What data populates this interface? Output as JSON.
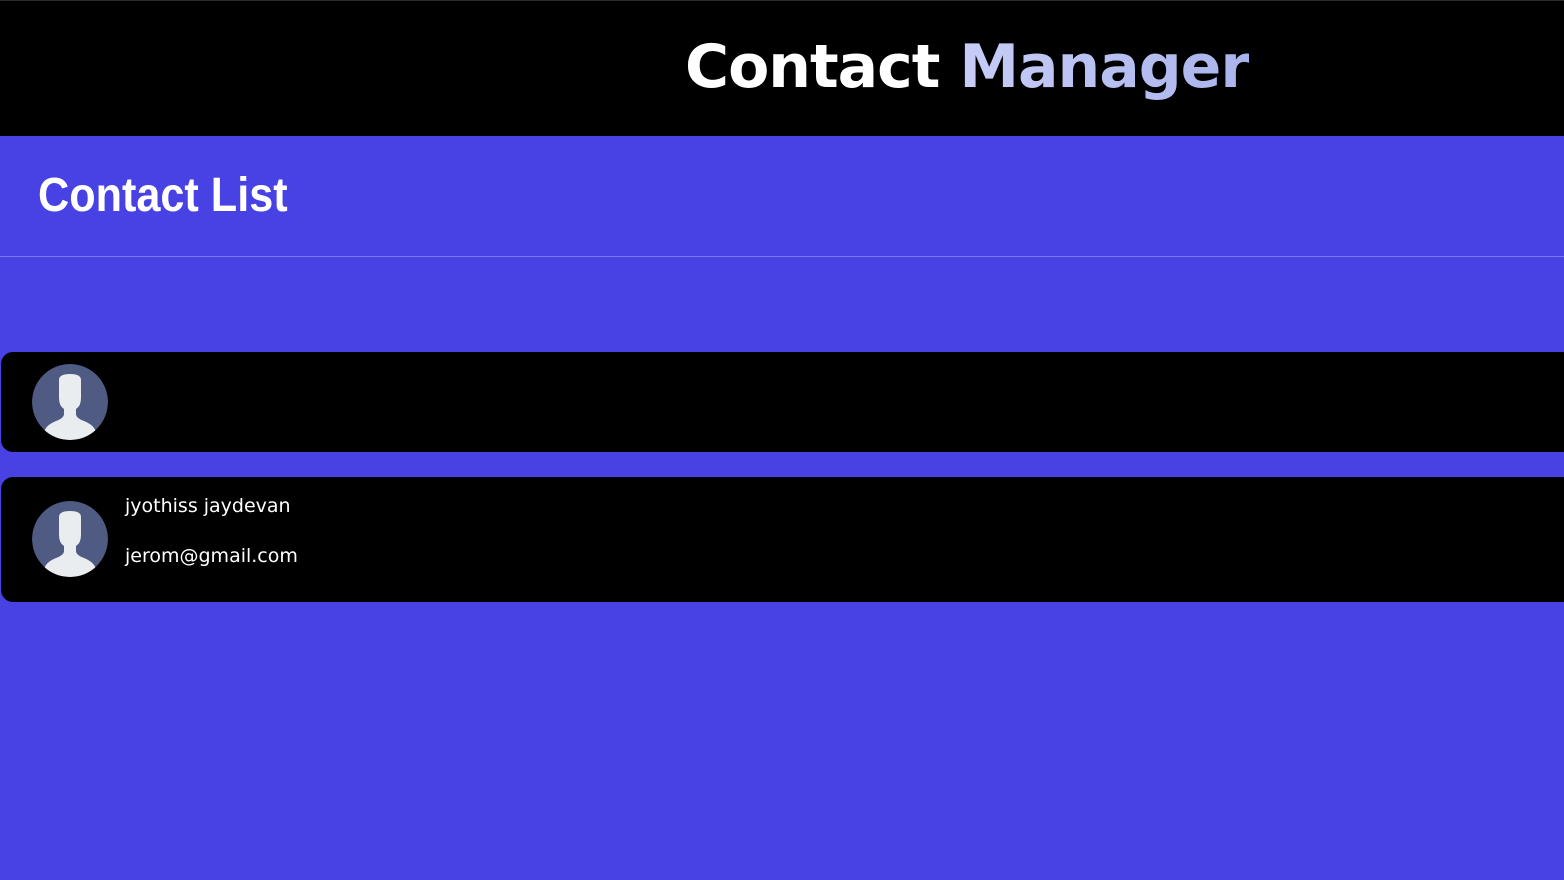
{
  "header": {
    "title_word1": "Contact",
    "title_word2": "Manager"
  },
  "contact_list": {
    "heading": "Contact List",
    "contacts": [
      {
        "name": "",
        "email": "",
        "avatar_icon": "user-silhouette-icon"
      },
      {
        "name": "jyothiss jaydevan",
        "email": "jerom@gmail.com",
        "avatar_icon": "user-silhouette-icon"
      }
    ]
  },
  "colors": {
    "background": "#4842e5",
    "header_background": "#000000",
    "card_background": "#000000",
    "title_accent": "#b8c0f0",
    "avatar_background": "#4f5b82",
    "avatar_silhouette": "#e9edf0"
  }
}
